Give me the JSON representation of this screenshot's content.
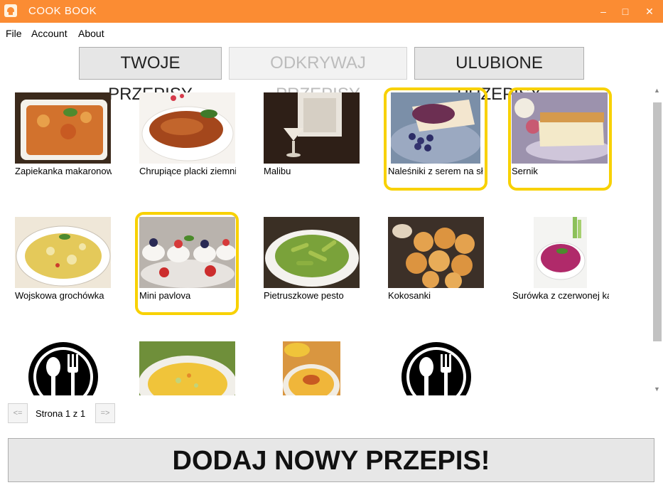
{
  "window": {
    "title": "COOK BOOK",
    "minimize": "–",
    "maximize": "□",
    "close": "✕"
  },
  "menu": [
    "File",
    "Account",
    "About"
  ],
  "tabs": [
    {
      "label": "TWOJE PRZEPISY",
      "enabled": true
    },
    {
      "label": "ODKRYWAJ PRZEPISY",
      "enabled": false
    },
    {
      "label": "ULUBIONE PRZEPISY",
      "enabled": true
    }
  ],
  "recipes": [
    {
      "name": "Zapiekanka makaronowa",
      "favorite": false,
      "image": "baked-pasta-dish"
    },
    {
      "name": "Chrupiące placki ziemniaczane",
      "favorite": false,
      "image": "potato-pancakes"
    },
    {
      "name": "Malibu",
      "favorite": false,
      "image": "malibu-cocktail"
    },
    {
      "name": "Naleśniki z serem na słodko",
      "favorite": true,
      "image": "crepes-with-blueberries"
    },
    {
      "name": "Sernik",
      "favorite": true,
      "image": "cheesecake-slice"
    },
    {
      "name": "Wojskowa grochówka",
      "favorite": false,
      "image": "pea-soup"
    },
    {
      "name": "Mini pavlova",
      "favorite": true,
      "image": "mini-pavlovas"
    },
    {
      "name": "Pietruszkowe pesto",
      "favorite": false,
      "image": "pesto-penne"
    },
    {
      "name": "Kokosanki",
      "favorite": false,
      "image": "coconut-macaroons"
    },
    {
      "name": "Surówka z czerwonej kapusty",
      "favorite": false,
      "image": "red-cabbage-salad"
    },
    {
      "name": "",
      "favorite": false,
      "image": "placeholder-cutlery-icon"
    },
    {
      "name": "",
      "favorite": false,
      "image": "yellow-soup-bowl"
    },
    {
      "name": "",
      "favorite": false,
      "image": "yellow-soup-small"
    },
    {
      "name": "",
      "favorite": false,
      "image": "placeholder-cutlery-icon"
    }
  ],
  "pager": {
    "prev": "<=",
    "next": "=>",
    "label": "Strona 1 z 1"
  },
  "add_button": "DODAJ NOWY PRZEPIS!",
  "colors": {
    "titlebar": "#fb8c33",
    "favorite_border": "#f8d100"
  }
}
